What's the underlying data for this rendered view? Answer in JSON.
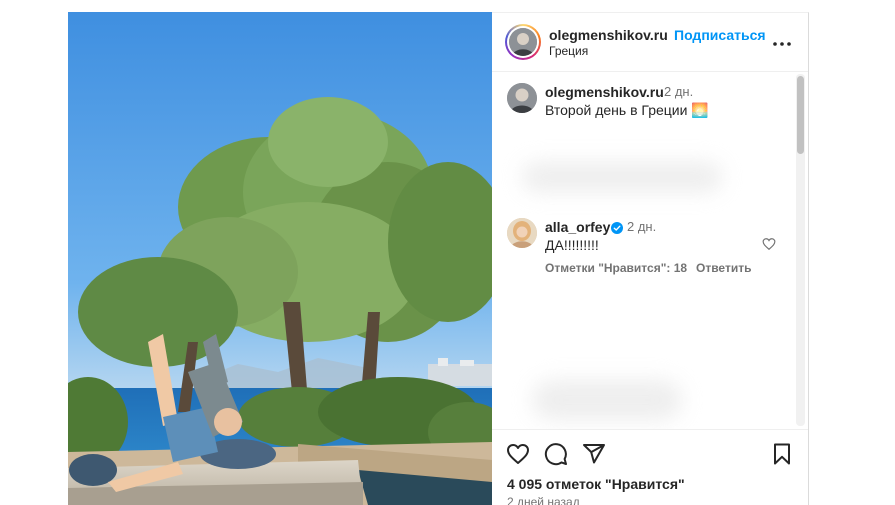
{
  "post": {
    "author": "olegmenshikov.ru",
    "follow_label": "Подписаться",
    "location": "Греция",
    "more_icon": "more-horizontal-icon"
  },
  "caption": {
    "author": "olegmenshikov.ru",
    "time": "2 дн.",
    "text": "Второй день в Греции",
    "emoji": "🌅"
  },
  "comment": {
    "author": "alla_orfey",
    "verified_icon": "verified-badge-icon",
    "time": "2 дн.",
    "text": "ДА!!!!!!!!!",
    "likes_label": "Отметки \"Нравится\": 18",
    "reply_label": "Ответить",
    "like_icon": "heart-outline-icon"
  },
  "actions": {
    "like_icon": "heart-outline-icon",
    "comment_icon": "comment-bubble-icon",
    "share_icon": "paper-plane-icon",
    "save_icon": "bookmark-outline-icon",
    "likes_text": "4 095 отметок \"Нравится\"",
    "date_text": "2 дней назад"
  },
  "colors": {
    "accent": "#0095f6",
    "verified": "#0095f6",
    "text": "#262626",
    "muted": "#737373"
  }
}
